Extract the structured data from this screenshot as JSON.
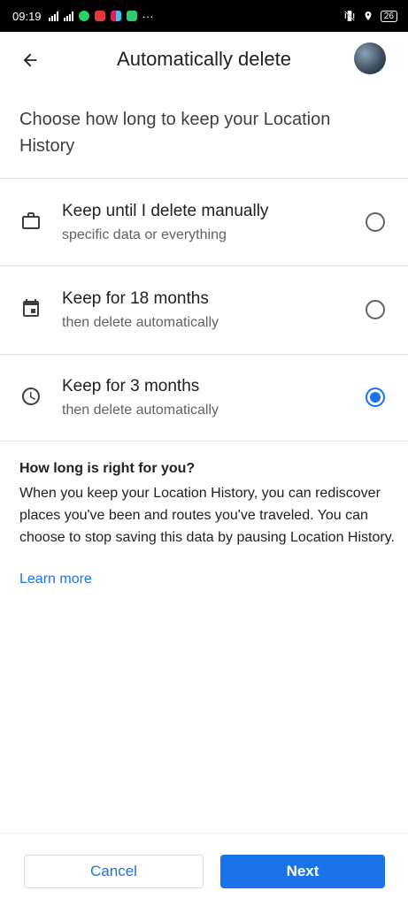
{
  "status_bar": {
    "time": "09:19",
    "battery": "26",
    "more": "···"
  },
  "app_bar": {
    "title": "Automatically delete"
  },
  "intro": {
    "text": "Choose how long to keep your Location History"
  },
  "options": [
    {
      "icon": "briefcase-icon",
      "title": "Keep until I delete manually",
      "subtitle": "specific data or everything",
      "selected": false
    },
    {
      "icon": "calendar-icon",
      "title": "Keep for 18 months",
      "subtitle": "then delete automatically",
      "selected": false
    },
    {
      "icon": "clock-icon",
      "title": "Keep for 3 months",
      "subtitle": "then delete automatically",
      "selected": true
    }
  ],
  "info": {
    "heading": "How long is right for you?",
    "body": "When you keep your Location History, you can rediscover places you've been and routes you've traveled. You can choose to stop saving this data by pausing Location History.",
    "learn_more": "Learn more"
  },
  "buttons": {
    "cancel": "Cancel",
    "next": "Next"
  },
  "colors": {
    "accent": "#1a73e8",
    "text_primary": "#202124",
    "text_secondary": "#5f6368"
  }
}
